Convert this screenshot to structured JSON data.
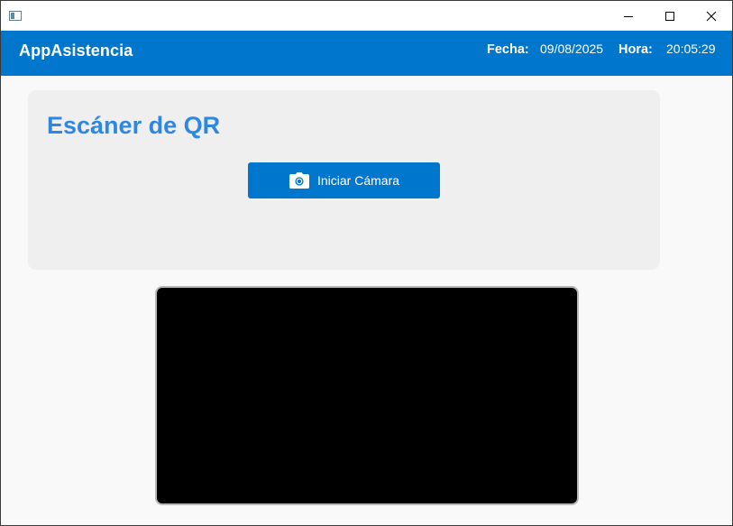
{
  "titlebar": {
    "minimize_icon": "minimize-icon",
    "maximize_icon": "maximize-icon",
    "close_icon": "close-icon"
  },
  "header": {
    "brand": "AppAsistencia",
    "fecha_label": "Fecha:",
    "fecha_value": "09/08/2025",
    "hora_label": "Hora:",
    "hora_value": "20:05:29"
  },
  "scanner": {
    "title": "Escáner de QR",
    "start_button_label": "Iniciar Cámara",
    "start_button_icon": "camera-icon"
  },
  "colors": {
    "accent": "#0077cc",
    "title": "#2f87e4",
    "card_bg": "#efefef",
    "preview_bg": "#000000"
  }
}
